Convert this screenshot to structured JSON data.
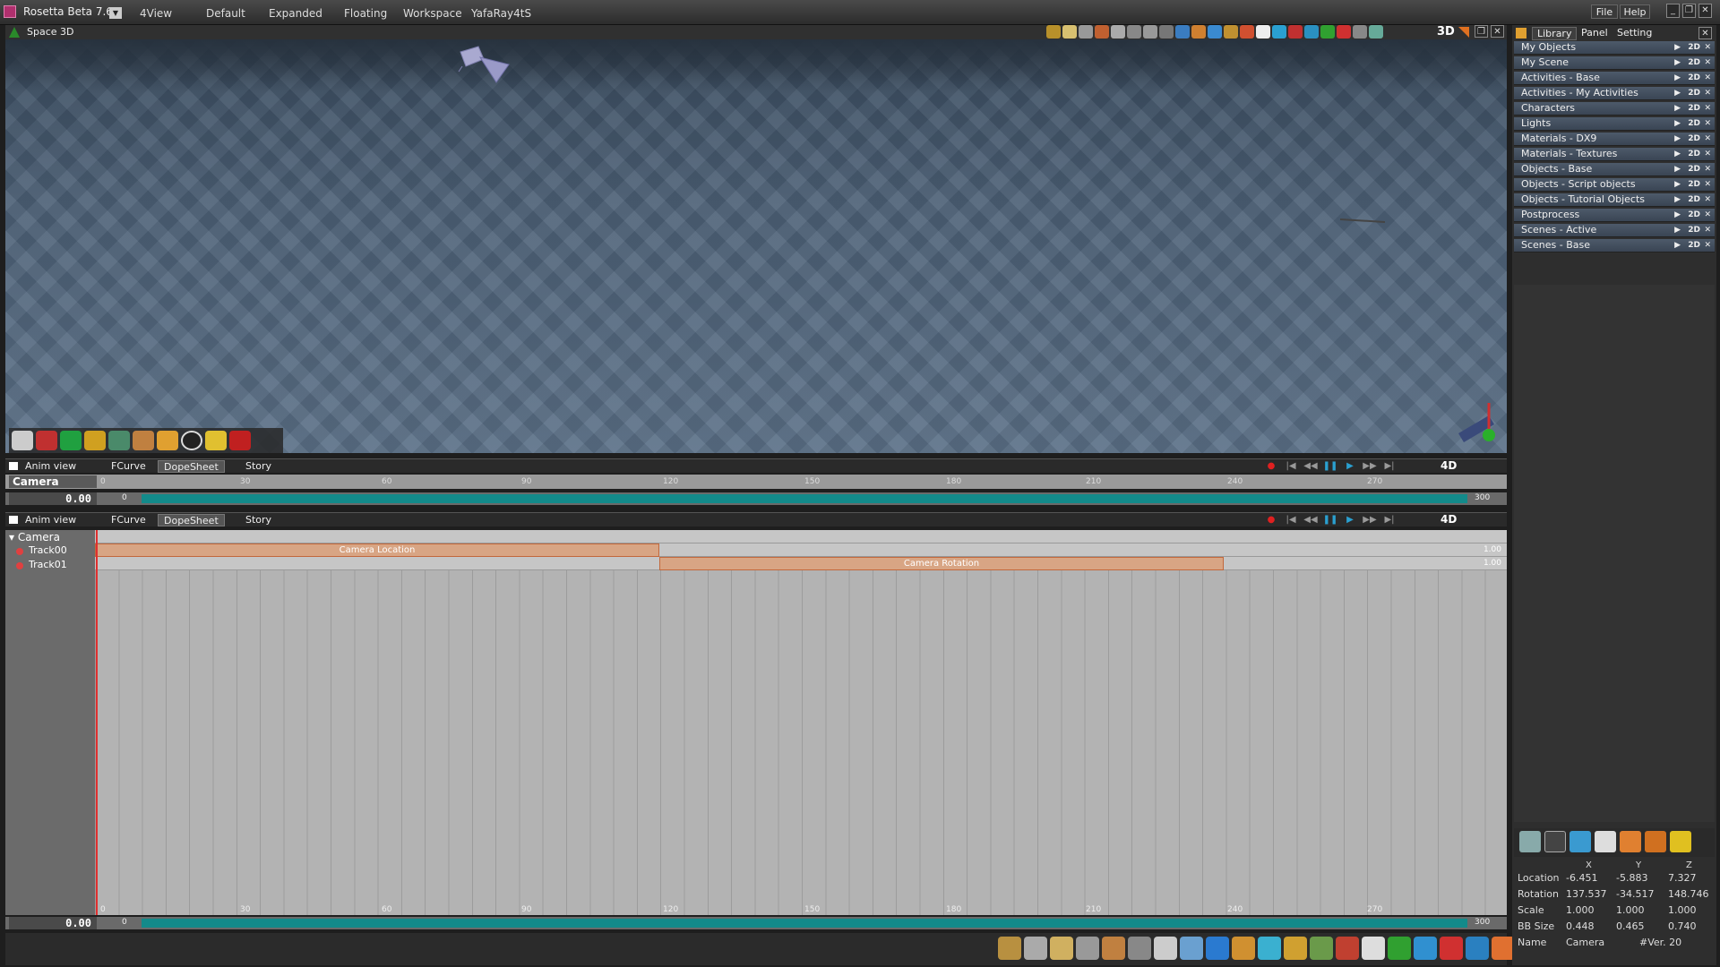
{
  "app": {
    "title": "Rosetta Beta 7.61"
  },
  "menu": {
    "tabs": [
      "4View",
      "Default",
      "Expanded",
      "Floating",
      "Workspace",
      "YafaRay4tS"
    ],
    "file": "File",
    "help": "Help"
  },
  "viewport": {
    "title": "Space 3D",
    "mode": "3D"
  },
  "anim_top": {
    "title": "Anim view",
    "tabs": [
      "FCurve",
      "DopeSheet",
      "Story"
    ],
    "mode": "4D",
    "object": "Camera",
    "time": "0.00",
    "ticks": [
      "0",
      "30",
      "60",
      "90",
      "120",
      "150",
      "180",
      "210",
      "240",
      "270"
    ],
    "start": "0",
    "end": "300"
  },
  "anim_bottom": {
    "title": "Anim view",
    "tabs": [
      "FCurve",
      "DopeSheet",
      "Story"
    ],
    "mode": "4D",
    "time": "0.00",
    "ticks": [
      "0",
      "30",
      "60",
      "90",
      "120",
      "150",
      "180",
      "210",
      "240",
      "270"
    ],
    "start": "0",
    "end": "300",
    "tree": {
      "root": "Camera",
      "tracks": [
        {
          "name": "Track00",
          "clip": "Camera Location",
          "value": "1.00",
          "start": 0,
          "end": 120
        },
        {
          "name": "Track01",
          "clip": "Camera Rotation",
          "value": "1.00",
          "start": 120,
          "end": 240
        }
      ]
    }
  },
  "right_panel": {
    "tabs": [
      "Library",
      "Panel",
      "Setting"
    ],
    "libraries": [
      "My Objects",
      "My Scene",
      "Activities - Base",
      "Activities - My Activities",
      "Characters",
      "Lights",
      "Materials - DX9",
      "Materials - Textures",
      "Objects - Base",
      "Objects - Script objects",
      "Objects - Tutorial Objects",
      "Postprocess",
      "Scenes - Active",
      "Scenes - Base"
    ],
    "lib_tag": "2D",
    "props": {
      "cols": [
        "X",
        "Y",
        "Z"
      ],
      "rows": [
        {
          "label": "Location",
          "x": "-6.451",
          "y": "-5.883",
          "z": "7.327"
        },
        {
          "label": "Rotation",
          "x": "137.537",
          "y": "-34.517",
          "z": "148.746"
        },
        {
          "label": "Scale",
          "x": "1.000",
          "y": "1.000",
          "z": "1.000"
        },
        {
          "label": "BB Size",
          "x": "0.448",
          "y": "0.465",
          "z": "0.740"
        }
      ],
      "name_label": "Name",
      "name_value": "Camera",
      "version": "#Ver. 20"
    }
  },
  "colors": {
    "accent": "#138a8a",
    "clip": "#d8a584",
    "record": "#e02020"
  }
}
